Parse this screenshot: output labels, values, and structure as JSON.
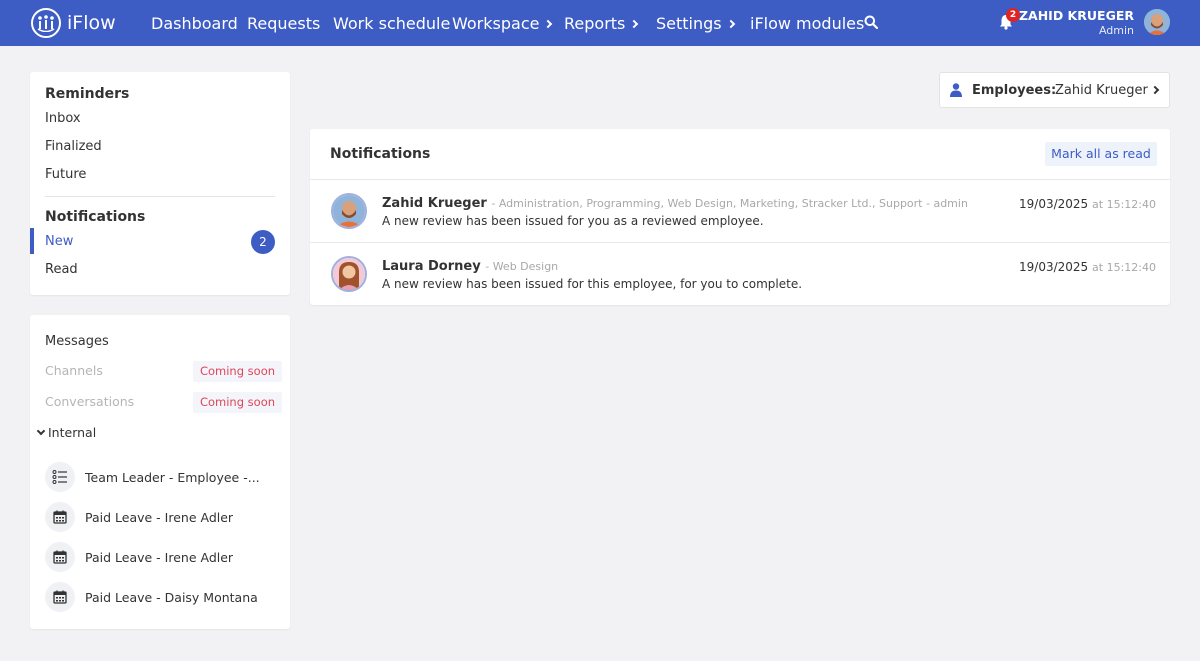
{
  "brand": {
    "name": "iFlow",
    "accent": "#3d5cc4"
  },
  "nav": {
    "items": [
      {
        "label": "Dashboard",
        "has_submenu": false
      },
      {
        "label": "Requests",
        "has_submenu": false
      },
      {
        "label": "Work schedule",
        "has_submenu": false
      },
      {
        "label": "Workspace",
        "has_submenu": true
      },
      {
        "label": "Reports",
        "has_submenu": true
      },
      {
        "label": "Settings",
        "has_submenu": true
      },
      {
        "label": "iFlow modules",
        "has_submenu": false
      }
    ],
    "search_icon": "search-icon"
  },
  "user": {
    "notifications_count": "2",
    "name": "ZAHID KRUEGER",
    "role": "Admin"
  },
  "sidebar": {
    "reminders": {
      "title": "Reminders",
      "items": [
        "Inbox",
        "Finalized",
        "Future"
      ]
    },
    "notifications": {
      "title": "Notifications",
      "items": [
        {
          "label": "New",
          "count": "2",
          "active": true
        },
        {
          "label": "Read"
        }
      ]
    }
  },
  "messages": {
    "title": "Messages",
    "disabled_items": [
      {
        "label": "Channels",
        "badge": "Coming soon"
      },
      {
        "label": "Conversations",
        "badge": "Coming soon"
      }
    ],
    "internal_label": "Internal",
    "conversations": [
      {
        "icon": "checklist-icon",
        "label": "Team Leader - Employee -..."
      },
      {
        "icon": "calendar-icon",
        "label": "Paid Leave - Irene Adler"
      },
      {
        "icon": "calendar-icon",
        "label": "Paid Leave - Irene Adler"
      },
      {
        "icon": "calendar-icon",
        "label": "Paid Leave - Daisy Montana"
      }
    ]
  },
  "employees": {
    "label": "Employees:",
    "value": "Zahid Krueger"
  },
  "notifications_panel": {
    "title": "Notifications",
    "mark_all_label": "Mark all as read",
    "items": [
      {
        "name": "Zahid Krueger",
        "dept": "- Administration, Programming, Web Design, Marketing, Stracker Ltd., Support - admin",
        "message": "A new review has been issued for you as a reviewed employee.",
        "date": "19/03/2025",
        "at": "at 15:12:40"
      },
      {
        "name": "Laura Dorney",
        "dept": "- Web Design",
        "message": "A new review has been issued for this employee, for you to complete.",
        "date": "19/03/2025",
        "at": "at 15:12:40"
      }
    ]
  }
}
